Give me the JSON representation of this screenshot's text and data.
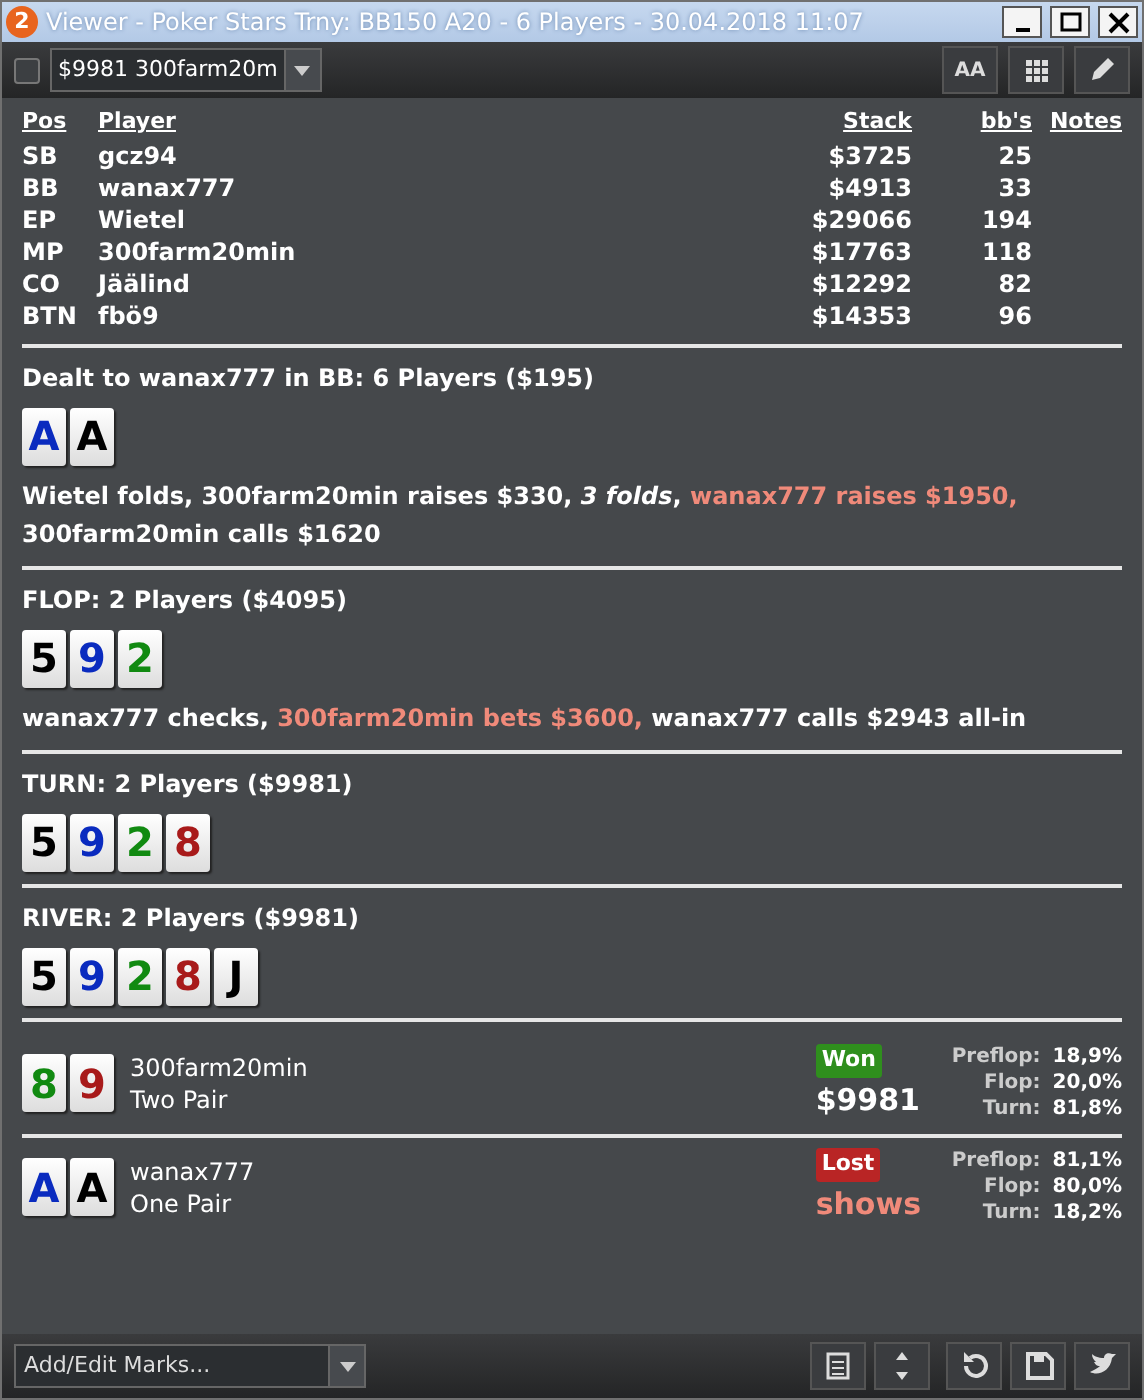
{
  "window": {
    "title": "Viewer - Poker Stars Trny: BB150 A20 - 6 Players - 30.04.2018 11:07",
    "badge": "2"
  },
  "toolbar": {
    "checked": false,
    "hand_select": "$9981 300farm20m",
    "font_button": "AA"
  },
  "players_table": {
    "columns": [
      "Pos",
      "Player",
      "Stack",
      "bb's",
      "Notes"
    ],
    "rows": [
      [
        "SB",
        "gcz94",
        "$3725",
        "25"
      ],
      [
        "BB",
        "wanax777",
        "$4913",
        "33"
      ],
      [
        "EP",
        "Wietel",
        "$29066",
        "194"
      ],
      [
        "MP",
        "300farm20min",
        "$17763",
        "118"
      ],
      [
        "CO",
        "Jäälind",
        "$12292",
        "82"
      ],
      [
        "BTN",
        "fbö9",
        "$14353",
        "96"
      ]
    ]
  },
  "streets": [
    {
      "header": "Dealt to wanax777 in BB: 6 Players ($195)",
      "cards": [
        {
          "rank": "A",
          "color": "#0a2bbf"
        },
        {
          "rank": "A",
          "color": "#000000"
        }
      ],
      "actions": [
        {
          "text": "Wietel folds, 300farm20min raises $330, *3 folds*, ",
          "kind": "plain"
        },
        {
          "text": "wanax777 raises $1950,",
          "kind": "accent"
        },
        {
          "text": " 300farm20min calls $1620",
          "kind": "plain"
        }
      ]
    },
    {
      "header": "FLOP: 2 Players ($4095)",
      "cards": [
        {
          "rank": "5",
          "color": "#000000"
        },
        {
          "rank": "9",
          "color": "#0a2bbf"
        },
        {
          "rank": "2",
          "color": "#118a11"
        }
      ],
      "actions": [
        {
          "text": "wanax777 checks, ",
          "kind": "plain"
        },
        {
          "text": "300farm20min bets $3600,",
          "kind": "accent"
        },
        {
          "text": " wanax777 calls $2943 all-in",
          "kind": "plain"
        }
      ]
    },
    {
      "header": "TURN: 2 Players ($9981)",
      "cards": [
        {
          "rank": "5",
          "color": "#000000"
        },
        {
          "rank": "9",
          "color": "#0a2bbf"
        },
        {
          "rank": "2",
          "color": "#118a11"
        },
        {
          "rank": "8",
          "color": "#a81a1a"
        }
      ]
    },
    {
      "header": "RIVER: 2 Players ($9981)",
      "cards": [
        {
          "rank": "5",
          "color": "#000000"
        },
        {
          "rank": "9",
          "color": "#0a2bbf"
        },
        {
          "rank": "2",
          "color": "#118a11"
        },
        {
          "rank": "8",
          "color": "#a81a1a"
        },
        {
          "rank": "J",
          "color": "#000000"
        }
      ]
    }
  ],
  "results": [
    {
      "cards": [
        {
          "rank": "8",
          "color": "#118a11"
        },
        {
          "rank": "9",
          "color": "#a81a1a"
        }
      ],
      "player": "300farm20min",
      "hand": "Two Pair",
      "outcome": "Won",
      "amount": "$9981",
      "kind": "won",
      "equity": [
        [
          "Preflop:",
          "18,9%"
        ],
        [
          "Flop:",
          "20,0%"
        ],
        [
          "Turn:",
          "81,8%"
        ]
      ]
    },
    {
      "cards": [
        {
          "rank": "A",
          "color": "#0a2bbf"
        },
        {
          "rank": "A",
          "color": "#000000"
        }
      ],
      "player": "wanax777",
      "hand": "One Pair",
      "outcome": "Lost",
      "amount": "shows",
      "kind": "lost",
      "equity": [
        [
          "Preflop:",
          "81,1%"
        ],
        [
          "Flop:",
          "80,0%"
        ],
        [
          "Turn:",
          "18,2%"
        ]
      ]
    }
  ],
  "footer": {
    "marks_placeholder": "Add/Edit Marks..."
  }
}
